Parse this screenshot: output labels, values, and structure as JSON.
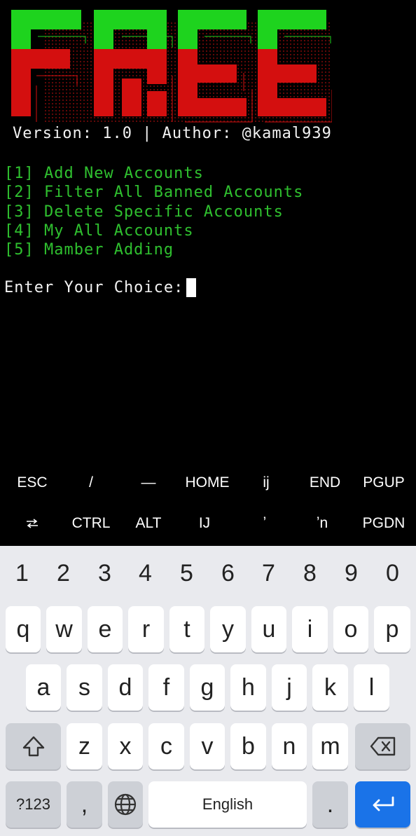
{
  "terminal": {
    "banner_text": "FREE",
    "version_line": "Version: 1.0 | Author: @kamal939",
    "menu_items": [
      "[1] Add New Accounts",
      "[2] Filter All Banned Accounts",
      "[3] Delete Specific Accounts",
      "[4] My All Accounts",
      "[5] Mamber Adding"
    ],
    "prompt": "Enter Your Choice:",
    "colors": {
      "menu_green": "#2fc02f",
      "banner_green": "#1ed31e",
      "banner_red": "#d40f0f"
    }
  },
  "extra_keys": {
    "row1": [
      "ESC",
      "/",
      "—",
      "HOME",
      "ij",
      "END",
      "PGUP"
    ],
    "row2": [
      "tab-icon",
      "CTRL",
      "ALT",
      "IJ",
      "ʼ",
      "ʼn",
      "PGDN"
    ]
  },
  "keyboard": {
    "numbers": [
      "1",
      "2",
      "3",
      "4",
      "5",
      "6",
      "7",
      "8",
      "9",
      "0"
    ],
    "row1": [
      "q",
      "w",
      "e",
      "r",
      "t",
      "y",
      "u",
      "i",
      "o",
      "p"
    ],
    "row2": [
      "a",
      "s",
      "d",
      "f",
      "g",
      "h",
      "j",
      "k",
      "l"
    ],
    "row3": [
      "z",
      "x",
      "c",
      "v",
      "b",
      "n",
      "m"
    ],
    "symbols_key": "?123",
    "comma_key": ",",
    "space_label": "English",
    "period_key": ".",
    "enter_color": "#1a73e8"
  }
}
